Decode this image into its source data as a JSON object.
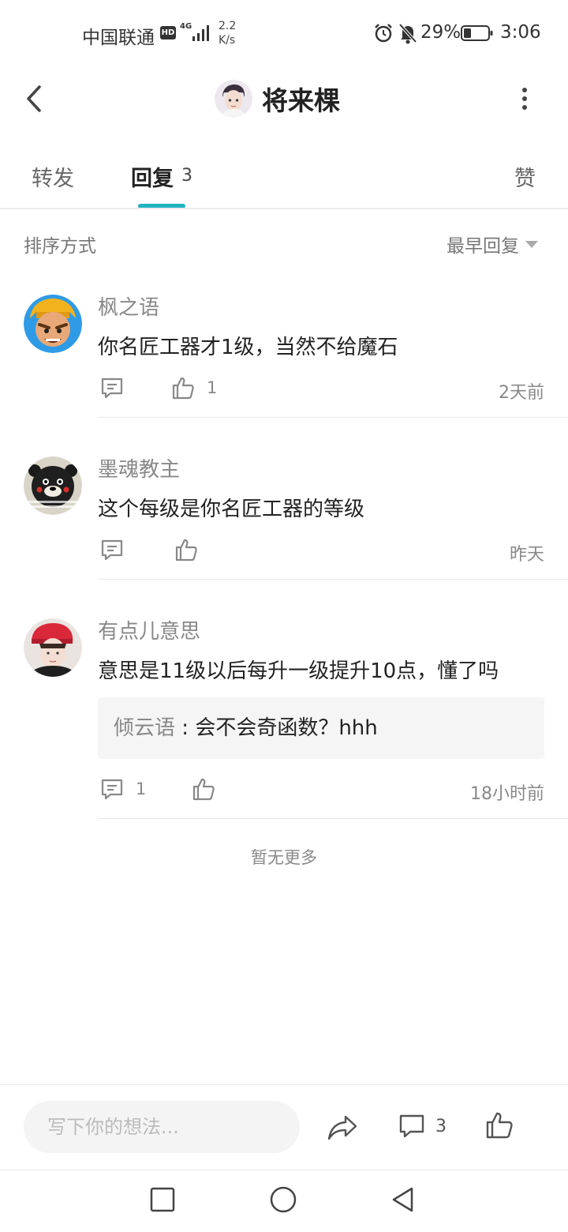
{
  "status_bar": {
    "carrier": "中国联通",
    "hd": "HD",
    "network": "4G",
    "speed_value": "2.2",
    "speed_unit": "K/s",
    "battery": "29%",
    "time": "3:06"
  },
  "header": {
    "title": "将来棵"
  },
  "tabs": {
    "forward": "转发",
    "reply": "回复",
    "reply_count": "3",
    "like": "赞"
  },
  "sort": {
    "label": "排序方式",
    "selected": "最早回复"
  },
  "comments": [
    {
      "author": "枫之语",
      "content": "你名匠工器才1级，当然不给魔石",
      "reply_count": "",
      "like_count": "1",
      "time": "2天前"
    },
    {
      "author": "墨魂教主",
      "content": "这个每级是你名匠工器的等级",
      "reply_count": "",
      "like_count": "",
      "time": "昨天"
    },
    {
      "author": "有点儿意思",
      "content": "意思是11级以后每升一级提升10点，懂了吗",
      "sub_reply": {
        "name": "倾云语",
        "separator": " : ",
        "text": "会不会奇函数？hhh"
      },
      "reply_count": "1",
      "like_count": "",
      "time": "18小时前"
    }
  ],
  "no_more": "暂无更多",
  "bottom_bar": {
    "input_placeholder": "写下你的想法...",
    "comment_count": "3"
  },
  "colors": {
    "accent": "#21b3c0",
    "text_primary": "#222222",
    "text_secondary": "#888888"
  },
  "icons": [
    "back-icon",
    "more-icon",
    "comment-icon",
    "like-icon",
    "share-icon",
    "caret-down-icon",
    "alarm-icon",
    "bell-off-icon",
    "battery-icon"
  ]
}
